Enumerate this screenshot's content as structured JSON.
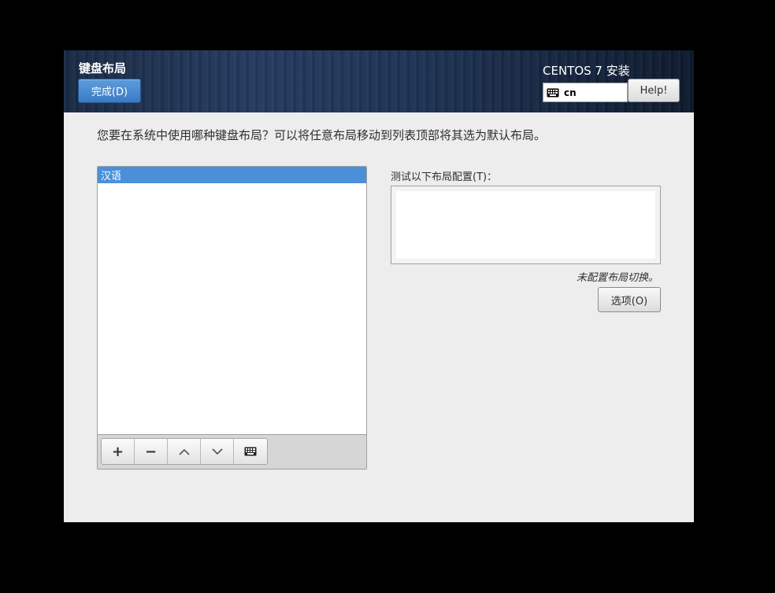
{
  "header": {
    "title": "键盘布局",
    "done_label": "完成(D)",
    "product_title": "CENTOS 7 安装",
    "keyboard_indicator": "cn",
    "help_label": "Help!"
  },
  "main": {
    "question": "您要在系统中使用哪种键盘布局？可以将任意布局移动到列表顶部将其选为默认布局。",
    "layouts": [
      "汉语"
    ],
    "toolbar": {
      "add": "+",
      "remove": "−",
      "up": "∧",
      "down": "∨"
    },
    "test_label": "测试以下布局配置(T)：",
    "switch_note": "未配置布局切换。",
    "options_label": "选项(O)"
  },
  "colors": {
    "accent": "#4a90d9",
    "header_bg": "#1e3354",
    "window_bg": "#ededed"
  }
}
